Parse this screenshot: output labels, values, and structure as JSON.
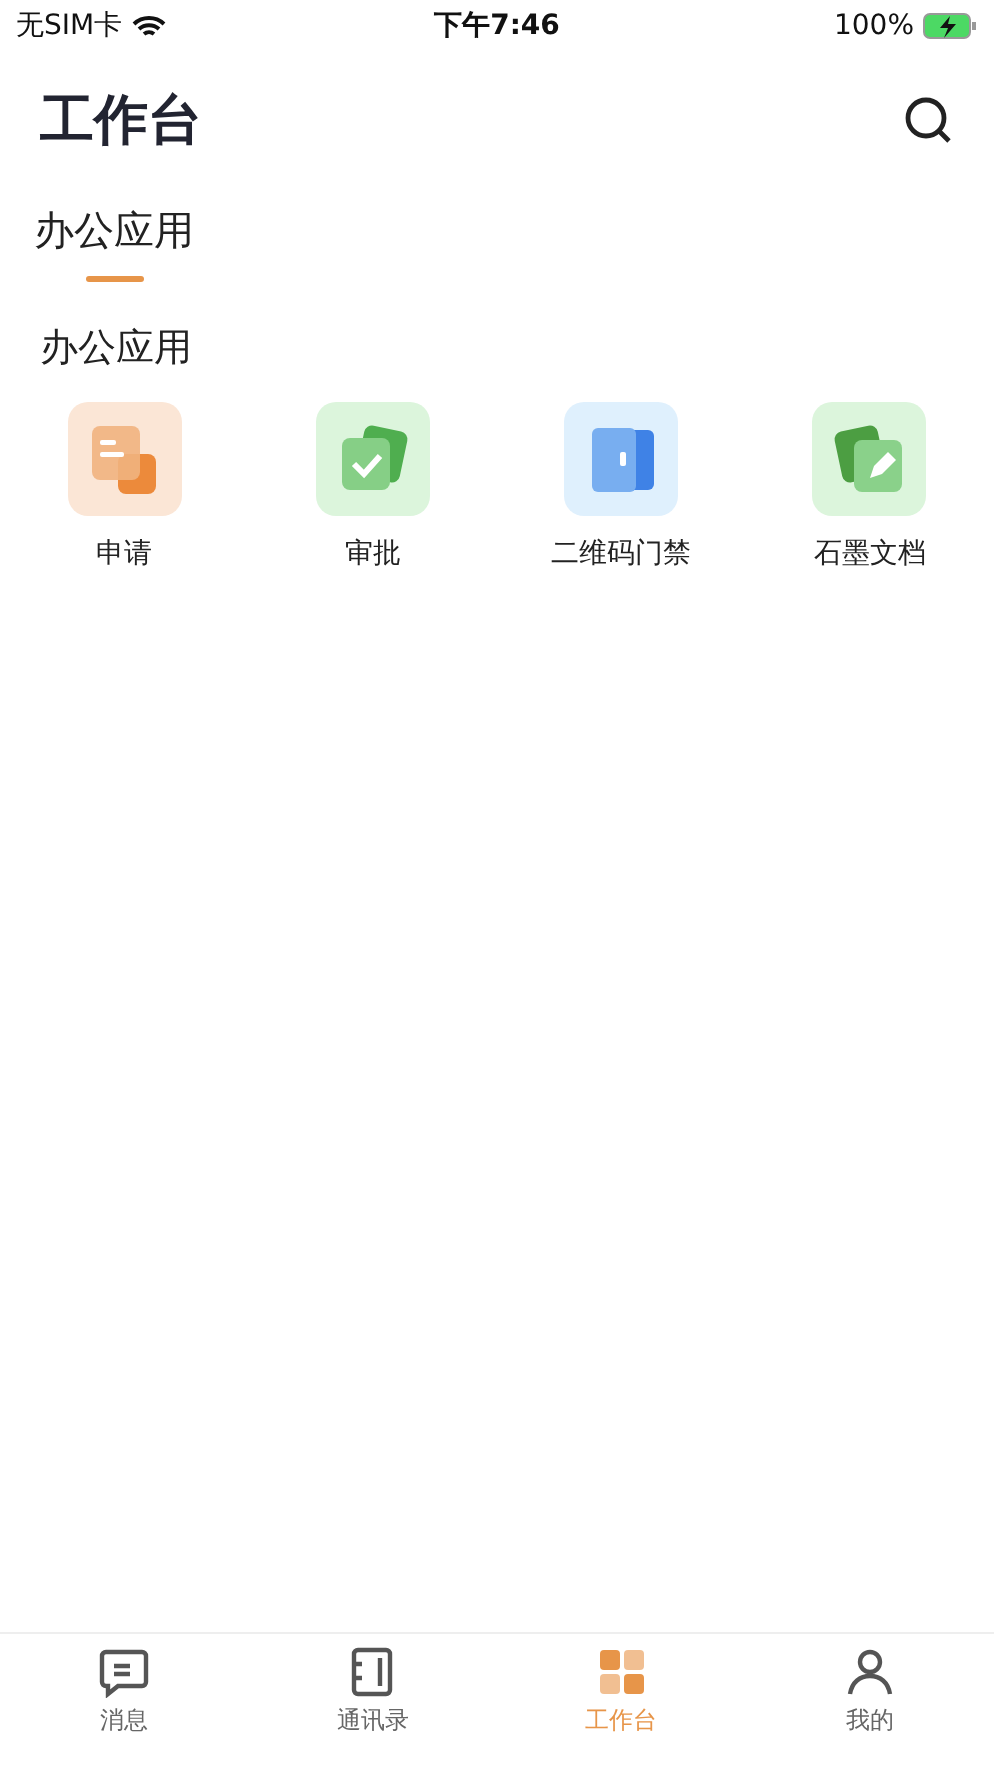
{
  "status_bar": {
    "carrier": "无SIM卡",
    "time": "下午7:46",
    "battery": "100%"
  },
  "header": {
    "title": "工作台"
  },
  "tabs": [
    {
      "label": "办公应用",
      "selected": true
    }
  ],
  "section": {
    "title": "办公应用",
    "apps": [
      {
        "label": "申请",
        "kind": "apply"
      },
      {
        "label": "审批",
        "kind": "approve"
      },
      {
        "label": "二维码门禁",
        "kind": "door"
      },
      {
        "label": "石墨文档",
        "kind": "doc"
      }
    ]
  },
  "tab_bar": [
    {
      "label": "消息",
      "kind": "message",
      "selected": false
    },
    {
      "label": "通讯录",
      "kind": "contacts",
      "selected": false
    },
    {
      "label": "工作台",
      "kind": "work",
      "selected": true
    },
    {
      "label": "我的",
      "kind": "me",
      "selected": false
    }
  ]
}
